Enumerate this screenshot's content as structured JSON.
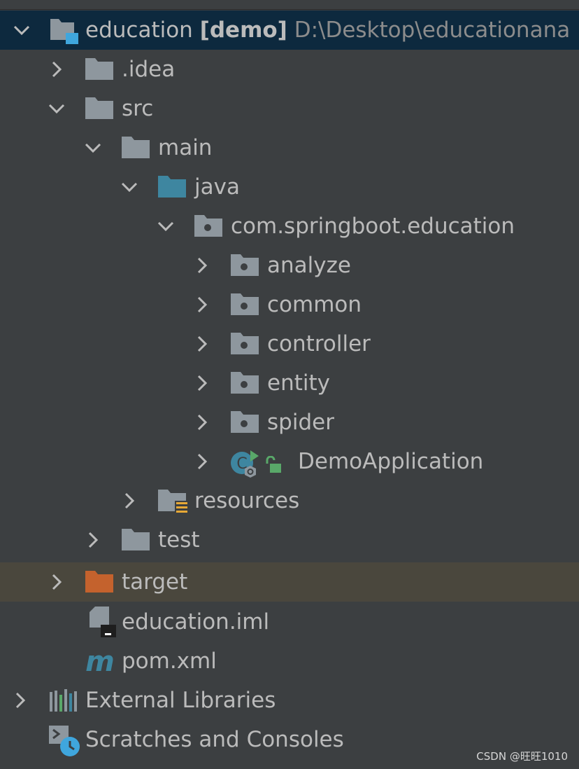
{
  "project": {
    "name": "education",
    "module": "[demo]",
    "path": "D:\\Desktop\\educationana"
  },
  "tree": {
    "idea": ".idea",
    "src": "src",
    "main": "main",
    "java": "java",
    "package": "com.springboot.education",
    "analyze": "analyze",
    "common": "common",
    "controller": "controller",
    "entity": "entity",
    "spider": "spider",
    "demo_app": "DemoApplication",
    "resources": "resources",
    "test": "test",
    "target": "target",
    "iml": "education.iml",
    "pom": "pom.xml",
    "ext_libs": "External Libraries",
    "scratches": "Scratches and Consoles"
  },
  "watermark": "CSDN @旺旺1010",
  "colors": {
    "background": "#3c3f41",
    "selected_row": "#0d293e",
    "highlight_row": "#4a473d",
    "folder_gray": "#8e979e",
    "source_folder_blue": "#3e86a0",
    "excluded_folder_orange": "#c4622d",
    "maven_blue": "#3e86a0"
  },
  "icons": {
    "project": "module-folder-icon",
    "folder": "folder-icon",
    "source_root": "source-folder-icon",
    "package": "package-icon",
    "spring_class": "spring-boot-class-icon",
    "resources": "resources-folder-icon",
    "excluded": "excluded-folder-icon",
    "iml": "iml-file-icon",
    "maven": "maven-icon",
    "libraries": "libraries-icon",
    "scratches": "scratches-icon"
  }
}
